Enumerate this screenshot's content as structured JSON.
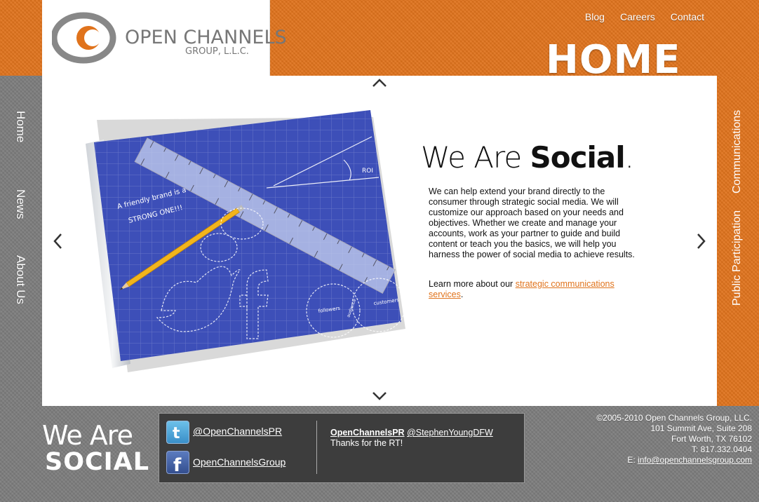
{
  "header": {
    "logo": {
      "name": "OPEN CHANNELS",
      "subtitle": "GROUP, L.L.C."
    },
    "nav": [
      "Blog",
      "Careers",
      "Contact"
    ],
    "page_heading": "HOME"
  },
  "left_nav": [
    "Home",
    "News",
    "About Us"
  ],
  "right_nav": [
    "Communications",
    "Public Participation"
  ],
  "hero": {
    "title_light": "We Are ",
    "title_bold": "Social",
    "title_end": ".",
    "body": "We can help extend your brand directly to the consumer through strategic social media. We will customize our approach based on your needs and objectives. Whether we create and manage your accounts, work as your partner to guide and build content or teach you the basics, we will help you harness the power of social media to achieve results.",
    "more_prefix": "Learn more about our ",
    "more_link": "strategic communications services",
    "more_suffix": "."
  },
  "illustration": {
    "chalk_text_line1": "A friendly brand is a",
    "chalk_text_line2": "STRONG ONE!!!",
    "roi_label": "ROI",
    "venn_left": "followers",
    "venn_middle": "audience",
    "venn_right": "customers"
  },
  "footer": {
    "logo_line1": "We Are",
    "logo_line2": "SOCIAL",
    "twitter_handle": "@OpenChannelsPR",
    "facebook_handle": "OpenChannelsGroup",
    "tweet": {
      "author": "OpenChannelsPR",
      "mention": "@StephenYoungDFW",
      "text": "Thanks for the RT!"
    },
    "contact": {
      "copyright": "©2005-2010 Open Channels Group, LLC.",
      "address1": "101 Summit Ave, Suite 208",
      "address2": "Fort Worth, TX 76102",
      "phone": "T: 817.332.0404",
      "email_prefix": "E: ",
      "email": "info@openchannelsgroup.com"
    }
  },
  "colors": {
    "brand_orange": "#e0731c",
    "texture_gray": "#7d7d7d",
    "blueprint_blue": "#3d4fb8"
  }
}
